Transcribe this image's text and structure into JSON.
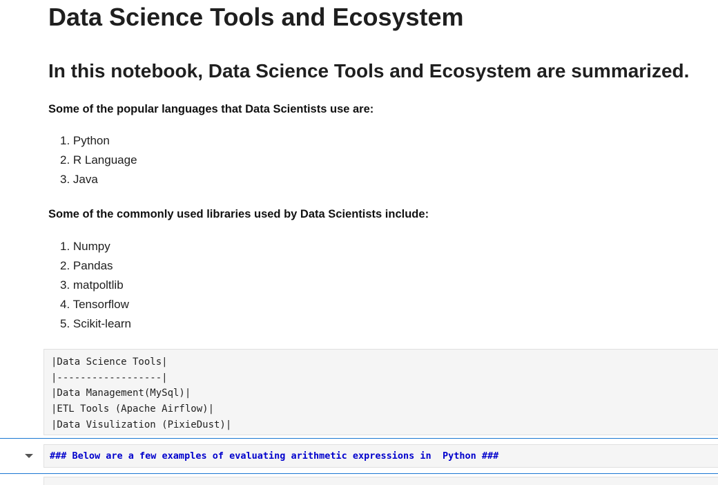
{
  "notebook": {
    "title": "Data Science Tools and Ecosystem",
    "subtitle": "In this notebook, Data Science Tools and Ecosystem are summarized.",
    "languages_heading": "Some of the popular languages that Data Scientists use are:",
    "languages": [
      "1. Python",
      "2. R Language",
      "3. Java"
    ],
    "libraries_heading": "Some of the commonly used libraries used by Data Scientists include:",
    "libraries": [
      "1. Numpy",
      "2. Pandas",
      "3. matpoltlib",
      "4. Tensorflow",
      "5. Scikit-learn"
    ],
    "table_cell_lines": [
      "|Data Science Tools|",
      "|------------------|",
      "|Data Management(MySql)|",
      "|ETL Tools (Apache Airflow)|",
      "|Data Visulization (PixieDust)|"
    ],
    "active_cell_source": "### Below are a few examples of evaluating arithmetic expressions in  Python ###"
  },
  "colors": {
    "active_border": "#1976d2",
    "markdown_heading_code": "#0000cc",
    "cell_background": "#f5f5f5"
  },
  "icons": {
    "collapse": "chevron-down-icon"
  }
}
